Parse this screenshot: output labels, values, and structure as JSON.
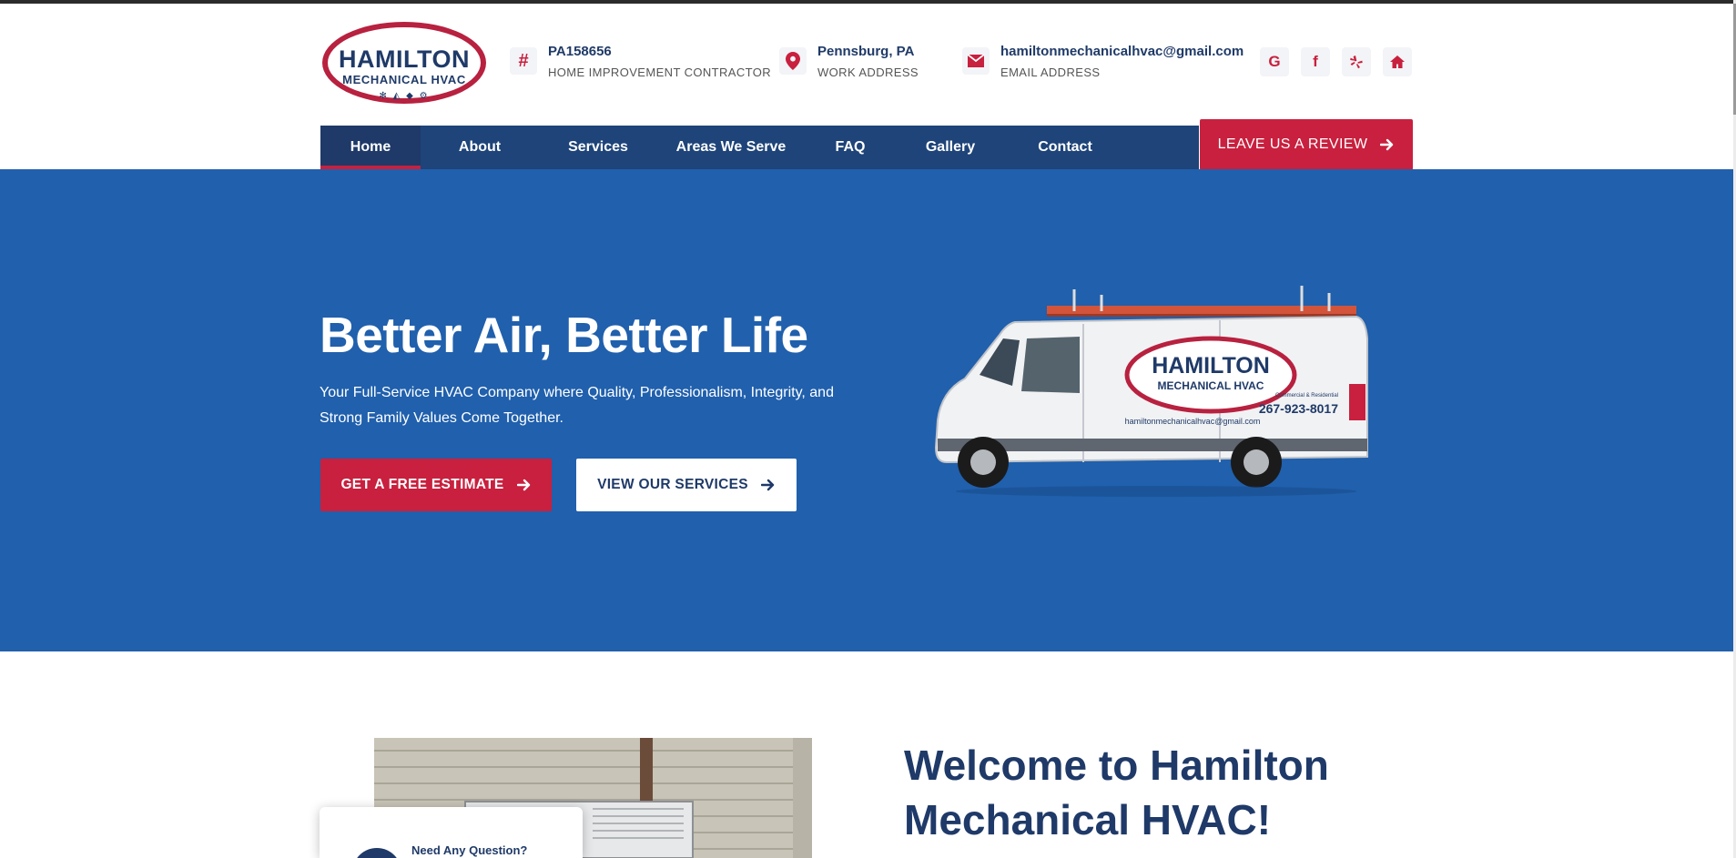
{
  "header": {
    "logo": {
      "line1": "HAMILTON",
      "line2": "MECHANICAL HVAC",
      "icons": "✻ ◭ ◆ ⚙"
    },
    "license": {
      "icon": "#",
      "title": "PA158656",
      "subtitle": "HOME IMPROVEMENT CONTRACTOR"
    },
    "address": {
      "icon": "map-pin-icon",
      "title": "Pennsburg, PA",
      "subtitle": "WORK ADDRESS"
    },
    "email": {
      "icon": "envelope-icon",
      "title": "hamiltonmechanicalhvac@gmail.com",
      "subtitle": "EMAIL ADDRESS"
    },
    "social": [
      {
        "name": "google",
        "glyph": "G"
      },
      {
        "name": "facebook",
        "glyph": "f"
      },
      {
        "name": "yelp",
        "glyph": "yelp-icon"
      },
      {
        "name": "home",
        "glyph": "home-icon"
      }
    ]
  },
  "nav": {
    "items": [
      {
        "label": "Home",
        "active": true
      },
      {
        "label": "About"
      },
      {
        "label": "Services"
      },
      {
        "label": "Areas We Serve"
      },
      {
        "label": "FAQ"
      },
      {
        "label": "Gallery"
      },
      {
        "label": "Contact"
      }
    ],
    "review_button": "LEAVE US A REVIEW"
  },
  "hero": {
    "title": "Better Air, Better Life",
    "text": "Your Full-Service HVAC Company where Quality, Professionalism, Integrity, and Strong Family Values Come Together.",
    "primary_button": "GET A FREE ESTIMATE",
    "secondary_button": "VIEW OUR SERVICES",
    "van": {
      "brand_line1": "HAMILTON",
      "brand_line2": "MECHANICAL HVAC",
      "phone": "267-923-8017",
      "email": "hamiltonmechanicalhvac@gmail.com",
      "tag": "Commercial & Residential"
    }
  },
  "welcome": {
    "title": "Welcome to Hamilton Mechanical HVAC!",
    "question_card": "Need Any Question?"
  },
  "colors": {
    "navy": "#1f3a68",
    "nav_bg": "#1e4479",
    "hero_bg": "#2060ad",
    "accent_red": "#c8203e"
  }
}
